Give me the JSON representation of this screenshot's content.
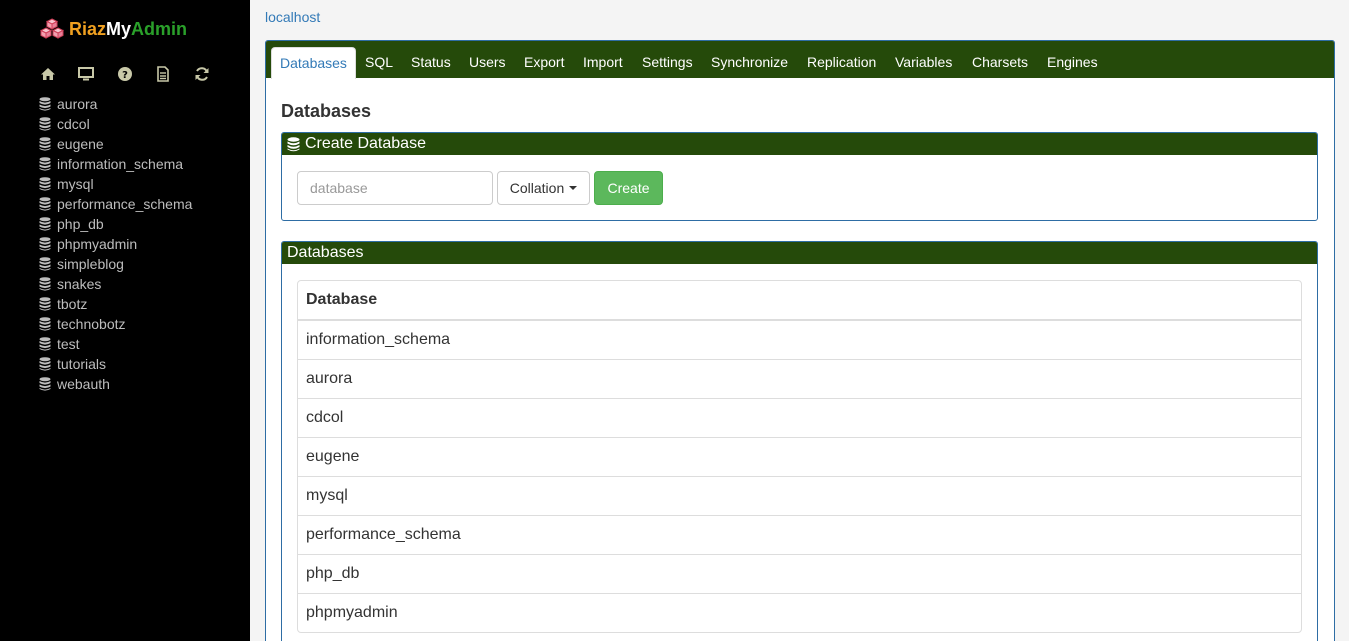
{
  "brand": {
    "part1": "Riaz",
    "part2": "My",
    "part3": "Admin"
  },
  "sidebar": {
    "tools": [
      {
        "icon": "home-icon"
      },
      {
        "icon": "monitor-icon"
      },
      {
        "icon": "help-icon"
      },
      {
        "icon": "document-icon"
      },
      {
        "icon": "refresh-icon"
      }
    ],
    "databases": [
      "aurora",
      "cdcol",
      "eugene",
      "information_schema",
      "mysql",
      "performance_schema",
      "php_db",
      "phpmyadmin",
      "simpleblog",
      "snakes",
      "tbotz",
      "technobotz",
      "test",
      "tutorials",
      "webauth"
    ]
  },
  "breadcrumb": {
    "host": "localhost"
  },
  "tabs": [
    "Databases",
    "SQL",
    "Status",
    "Users",
    "Export",
    "Import",
    "Settings",
    "Synchronize",
    "Replication",
    "Variables",
    "Charsets",
    "Engines"
  ],
  "active_tab": "Databases",
  "page_title": "Databases",
  "create_db": {
    "header": "Create Database",
    "placeholder": "database",
    "collation_label": "Collation",
    "create_label": "Create"
  },
  "db_table": {
    "header": "Databases",
    "column": "Database",
    "rows": [
      "information_schema",
      "aurora",
      "cdcol",
      "eugene",
      "mysql",
      "performance_schema",
      "php_db",
      "phpmyadmin"
    ]
  },
  "colors": {
    "sidebar_bg": "#000000",
    "header_green": "#254a0a",
    "link_blue": "#337ab7",
    "create_green": "#5cb85c",
    "brand_orange": "#f0a020",
    "brand_green": "#2aa02a"
  }
}
